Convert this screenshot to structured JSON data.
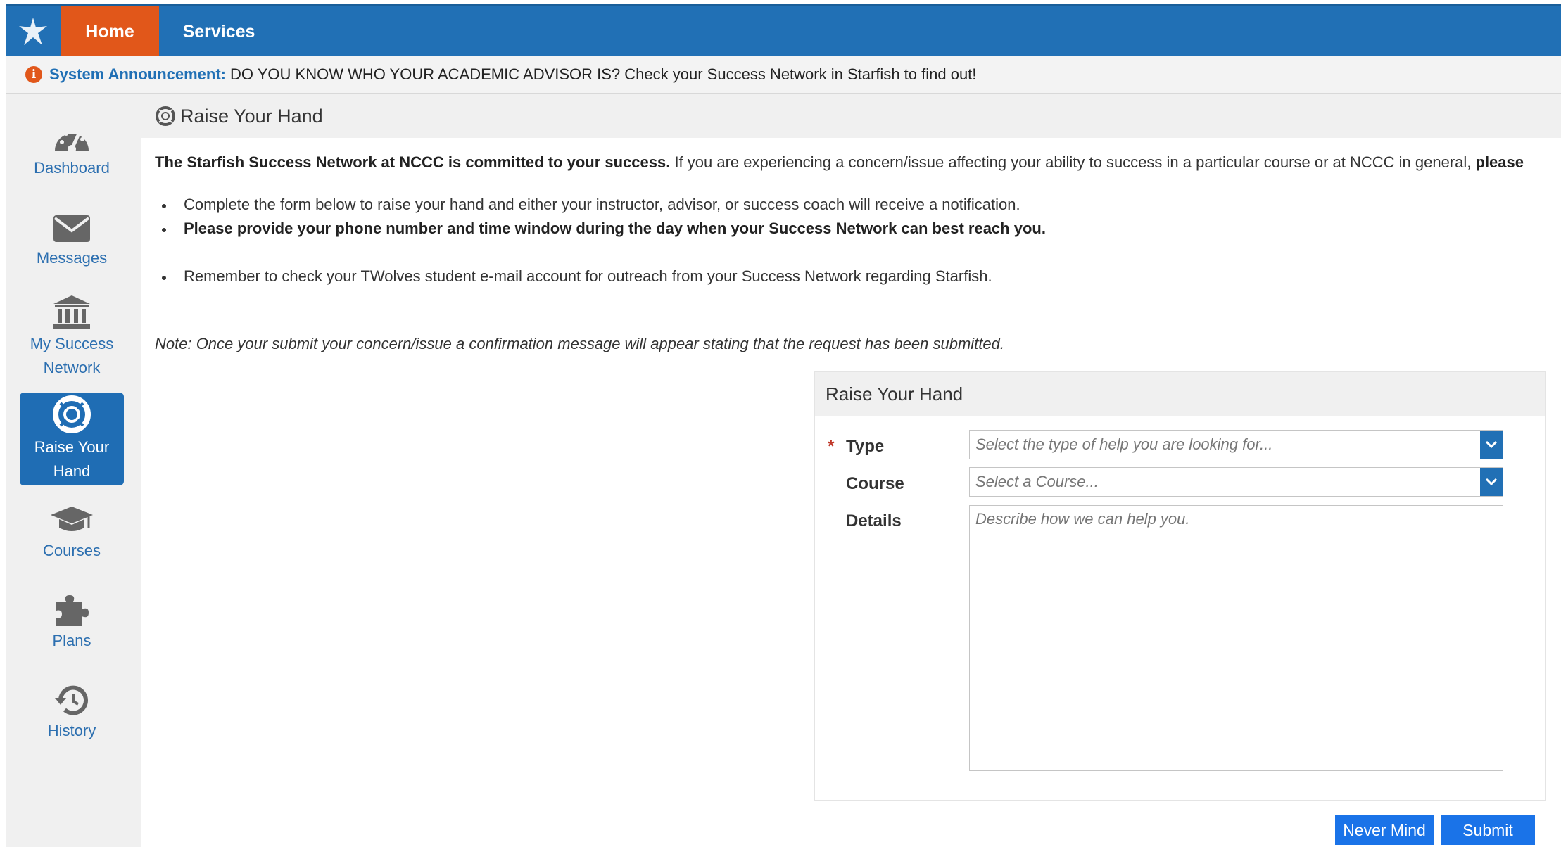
{
  "nav": {
    "tabs": [
      {
        "label": "Home",
        "active": true
      },
      {
        "label": "Services",
        "active": false
      }
    ],
    "logo_icon": "starfish-logo-icon",
    "colors": {
      "bar": "#2170b5",
      "active_tab": "#e1571a"
    }
  },
  "announcement": {
    "icon": "info-icon",
    "label": "System Announcement:",
    "text": "DO YOU KNOW WHO YOUR ACADEMIC ADVISOR IS? Check your Success Network in Starfish to find out!"
  },
  "sidebar": {
    "items": [
      {
        "label_lines": [
          "Dashboard"
        ],
        "icon": "dashboard-gauge-icon",
        "active": false
      },
      {
        "label_lines": [
          "Messages"
        ],
        "icon": "envelope-icon",
        "active": false
      },
      {
        "label_lines": [
          "My Success",
          "Network"
        ],
        "icon": "institution-icon",
        "active": false
      },
      {
        "label_lines": [
          "Raise Your",
          "Hand"
        ],
        "icon": "lifebuoy-icon",
        "active": true
      },
      {
        "label_lines": [
          "Courses"
        ],
        "icon": "graduation-cap-icon",
        "active": false
      },
      {
        "label_lines": [
          "Plans"
        ],
        "icon": "puzzle-piece-icon",
        "active": false
      },
      {
        "label_lines": [
          "History"
        ],
        "icon": "history-icon",
        "active": false
      }
    ]
  },
  "page": {
    "title": "Raise Your Hand",
    "intro_bold": "The Starfish Success Network at NCCC is committed to your success.",
    "intro_rest": " If you are experiencing a concern/issue affecting your ability to success in a particular course or at NCCC in general, ",
    "intro_cut": "please",
    "bullets": [
      "Complete the form below to raise your hand and either your instructor, advisor, or success coach will receive a notification.",
      "Please provide your phone number and time window during the day when your Success Network can best reach you.",
      "Remember to check your TWolves student e-mail account for outreach from your Success Network regarding Starfish."
    ],
    "note": "Note: Once your submit your concern/issue a confirmation message will appear stating that the request has been submitted."
  },
  "form": {
    "title": "Raise Your Hand",
    "required_mark": "*",
    "type_label": "Type",
    "type_placeholder": "Select the type of help you are looking for...",
    "course_label": "Course",
    "course_placeholder": "Select a Course...",
    "details_label": "Details",
    "details_placeholder": "Describe how we can help you.",
    "cancel_label": "Never Mind",
    "submit_label": "Submit"
  }
}
